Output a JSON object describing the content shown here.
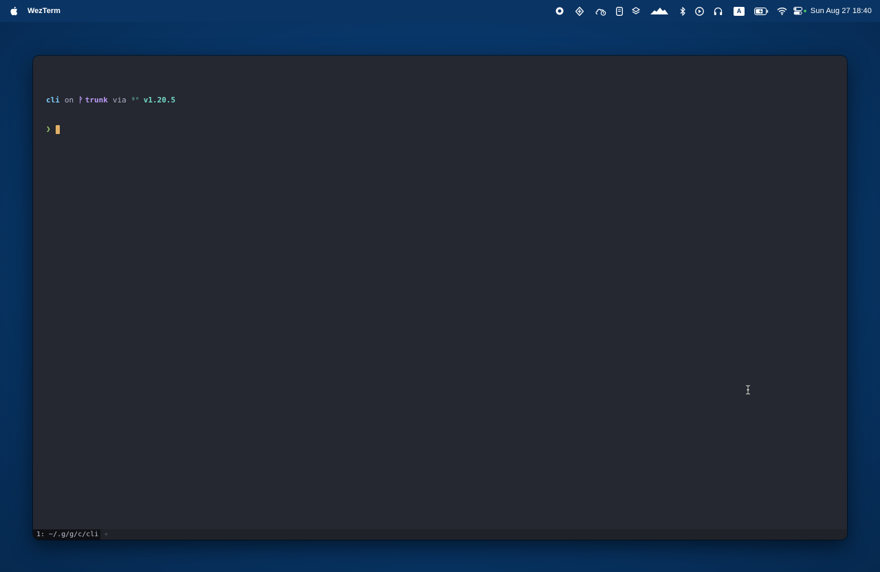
{
  "menubar": {
    "app_name": "WezTerm",
    "clock": "Sun Aug 27  18:40",
    "status_icons": [
      "record-icon",
      "tray-app-icon",
      "cloud-clock-icon",
      "notes-icon",
      "layers-icon",
      "mountain-app-icon",
      "bluetooth-icon",
      "play-icon",
      "headphones-icon",
      "keyboard-input-icon",
      "battery-icon",
      "wifi-icon",
      "control-center-icon"
    ],
    "input_source": "A"
  },
  "terminal": {
    "prompt": {
      "dir": "cli",
      "on": "on",
      "branch_icon": "ᚹ",
      "branch": "trunk",
      "via": "via",
      "go_icon": "ᵍᵒ",
      "version": "v1.20.5"
    },
    "prompt_symbol": "❯"
  },
  "tabbar": {
    "tabs": [
      {
        "label": "1: ~/.g/g/c/cli"
      }
    ],
    "new_tab": "+"
  },
  "colors": {
    "desktop": "#083566",
    "window_bg": "#252830",
    "dir": "#7dcfff",
    "branch": "#bb9af7",
    "version": "#73daca",
    "prompt_arrow": "#9ece6a",
    "cursor": "#e0af68"
  }
}
